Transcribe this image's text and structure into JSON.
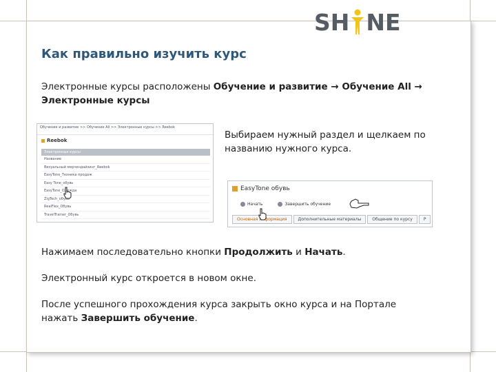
{
  "logo": {
    "text_left": "SH",
    "text_right": "NE"
  },
  "title": "Как правильно изучить курс",
  "intro": {
    "prefix": "Электронные курсы расположены ",
    "path_part1": "Обучение и развитие → Обучение All →",
    "path_part2": "Электронные курсы"
  },
  "right_text": {
    "line1": "Выбираем нужный раздел и щелкаем по",
    "line2": "названию нужного курса."
  },
  "screenshot_course_list": {
    "breadcrumb": "Обучение и развитие >> Обучение All >> Электронные курсы >> Reebok",
    "brand": "Reebok",
    "header": "Электронные курсы",
    "rows": [
      "Название",
      "Визуальный мерчендайзинг_Reebok",
      "EasyTone_Техника продаж",
      "Easy Tone_обувь",
      "EasyTone_Одежда",
      "ZigTech_обувь",
      "RealFlex_Обувь",
      "TravelTrainer_Обувь"
    ]
  },
  "screenshot_course_page": {
    "title": "EasyTone обувь",
    "start_label": "Начать",
    "finish_label": "Завершить обучение",
    "tabs": [
      "Основная информация",
      "Дополнительные материалы",
      "Общение по курсу",
      "Р"
    ]
  },
  "step1": {
    "prefix": "Нажимаем последовательно кнопки ",
    "continue": "Продолжить",
    "and": " и ",
    "start": "Начать",
    "suffix": "."
  },
  "step2": "Электронный курс откроется в новом окне.",
  "step3": {
    "line1": "После успешного прохождения курса  закрыть окно курса и на Портале",
    "line2_prefix": "нажать ",
    "line2_bold": "Завершить обучение",
    "line2_suffix": "."
  },
  "colors": {
    "title": "#2f5878",
    "logo": "#565c63",
    "logo_figure": "#f0c419",
    "frame": "#c9c3b8"
  }
}
